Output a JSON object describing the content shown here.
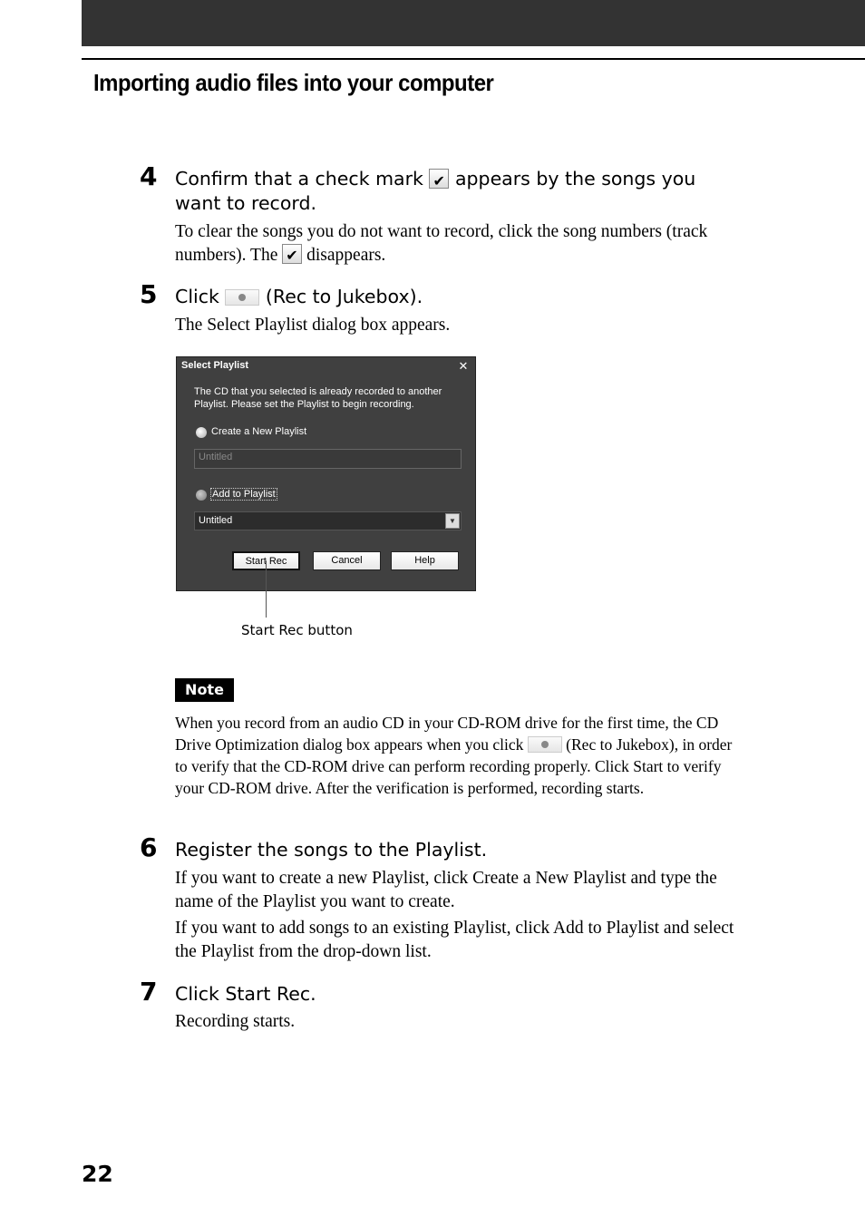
{
  "header": {
    "section_title": "Importing audio files into your computer"
  },
  "steps": [
    {
      "number": "4",
      "heading_parts": [
        "Confirm that a check mark",
        "appears by the songs you want to record."
      ],
      "body_parts": [
        "To clear the songs you do not want to record, click the song numbers (track numbers). The",
        "disappears."
      ]
    },
    {
      "number": "5",
      "heading_parts": [
        "Click",
        "(Rec to Jukebox)."
      ],
      "body": "The Select Playlist dialog box appears."
    },
    {
      "number": "6",
      "heading": "Register the songs to the Playlist.",
      "body": [
        "If you want to create a new Playlist, click Create a New Playlist and type the name of the Playlist you want to create.",
        "If you want to add songs to an existing Playlist, click Add to Playlist and select the Playlist from the drop-down list."
      ]
    },
    {
      "number": "7",
      "heading": "Click Start Rec.",
      "body": "Recording starts."
    }
  ],
  "dialog": {
    "title": "Select Playlist",
    "close_glyph": "✕",
    "message": "The CD that you selected is already recorded to another Playlist. Please set the Playlist to begin recording.",
    "option_new_label": "Create a New Playlist",
    "new_playlist_placeholder": "Untitled",
    "option_add_label": "Add to Playlist",
    "selected_option": "Add to Playlist",
    "playlist_dropdown_value": "Untitled",
    "dropdown_arrow": "▼",
    "buttons": {
      "start_rec": "Start Rec",
      "cancel": "Cancel",
      "help": "Help"
    }
  },
  "callout": {
    "label": "Start Rec button"
  },
  "note": {
    "badge": "Note",
    "text_parts": [
      "When you record from an audio CD in your CD-ROM drive for the first time, the CD Drive Optimization dialog box appears when you click",
      "(Rec to Jukebox), in order to verify that the CD-ROM drive can perform recording properly. Click Start to verify your CD-ROM drive. After the verification is performed, recording starts."
    ]
  },
  "footer": {
    "page_number": "22"
  }
}
